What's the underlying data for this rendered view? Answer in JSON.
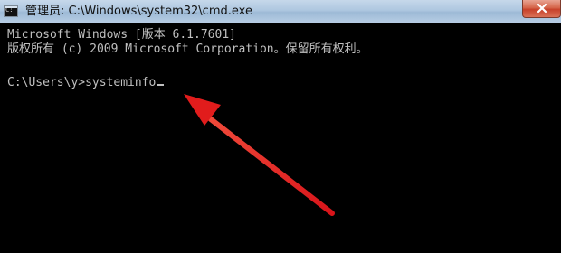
{
  "window": {
    "title": "管理员: C:\\Windows\\system32\\cmd.exe",
    "icon": "cmd-icon",
    "close_icon": "close-icon"
  },
  "console": {
    "lines": [
      "Microsoft Windows [版本 6.1.7601]",
      "版权所有 (c) 2009 Microsoft Corporation。保留所有权利。",
      "",
      "C:\\Users\\y>systeminfo"
    ]
  },
  "annotation": {
    "type": "arrow",
    "color": "#e8201c",
    "points_to": "systeminfo command"
  }
}
